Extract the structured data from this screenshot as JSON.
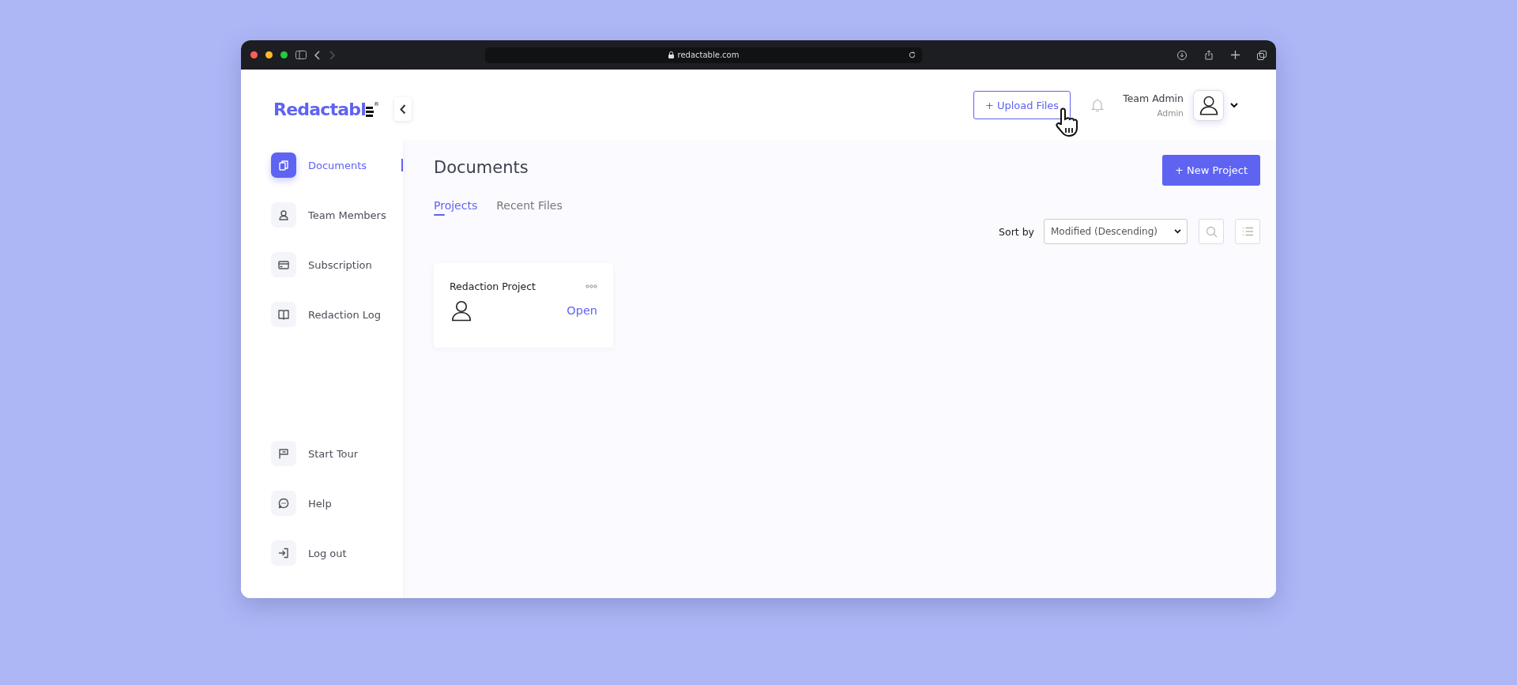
{
  "browser": {
    "url": "redactable.com"
  },
  "sidebar": {
    "logo": "Redactabl",
    "logo_mark": "®",
    "items": [
      {
        "label": "Documents",
        "selected": true
      },
      {
        "label": "Team Members",
        "selected": false
      },
      {
        "label": "Subscription",
        "selected": false
      },
      {
        "label": "Redaction Log",
        "selected": false
      }
    ],
    "bottom_items": [
      {
        "label": "Start Tour"
      },
      {
        "label": "Help"
      },
      {
        "label": "Log out"
      }
    ]
  },
  "header": {
    "upload_button": "+ Upload Files",
    "user_name": "Team Admin",
    "user_role": "Admin"
  },
  "content": {
    "title": "Documents",
    "new_project_button": "+ New Project",
    "tabs": [
      {
        "label": "Projects",
        "selected": true
      },
      {
        "label": "Recent Files",
        "selected": false
      }
    ],
    "sort_label": "Sort by",
    "sort_value": "Modified (Descending)",
    "projects": [
      {
        "name": "Redaction Project",
        "action": "Open"
      }
    ]
  }
}
